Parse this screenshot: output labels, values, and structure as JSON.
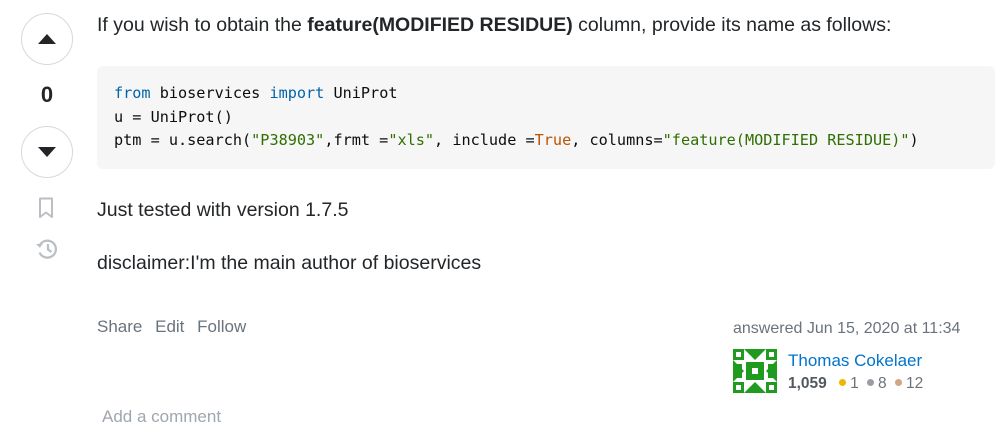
{
  "vote": {
    "count": "0"
  },
  "post": {
    "intro_before": "If you wish to obtain the ",
    "intro_bold": "feature(MODIFIED RESIDUE)",
    "intro_after": " column, provide its name as follows:",
    "code": {
      "l1_kw1": "from",
      "l1_t1": " bioservices ",
      "l1_kw2": "import",
      "l1_t2": " UniProt",
      "l2": "u = UniProt()",
      "l3_t1": "ptm = u.search(",
      "l3_s1": "\"P38903\"",
      "l3_t2": ",frmt =",
      "l3_s2": "\"xls\"",
      "l3_t3": ", include =",
      "l3_lit": "True",
      "l3_t4": ", columns=",
      "l3_s3": "\"feature(MODIFIED RESIDUE)\"",
      "l3_t5": ")"
    },
    "para2": "Just tested with version 1.7.5",
    "para3": "disclaimer:I'm the main author of bioservices"
  },
  "menu": {
    "share": "Share",
    "edit": "Edit",
    "follow": "Follow"
  },
  "signature": {
    "action": "answered Jun 15, 2020 at 11:34",
    "user_name": "Thomas Cokelaer",
    "reputation": "1,059",
    "gold": "1",
    "silver": "8",
    "bronze": "12"
  },
  "colors": {
    "gold": "#f1b600",
    "silver": "#9a9ea2",
    "bronze": "#d1a684",
    "avatar": "#1f9b1f"
  },
  "comment": {
    "add_label": "Add a comment"
  }
}
